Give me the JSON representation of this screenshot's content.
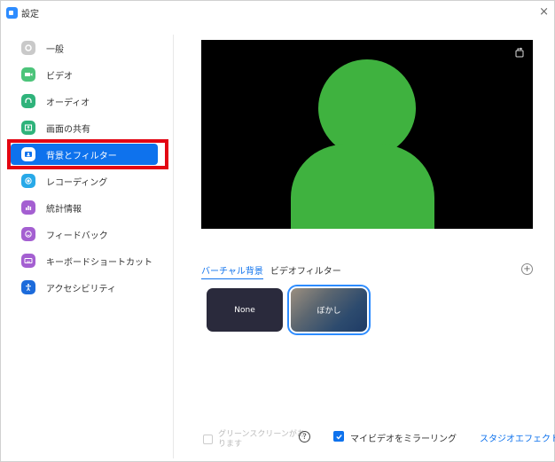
{
  "window": {
    "title": "設定",
    "close_glyph": "×",
    "accent_color": "#2D8CFF",
    "selection_color": "#0E72ED",
    "highlight_color": "#E30613"
  },
  "sidebar": {
    "items": [
      {
        "label": "一般",
        "icon": "gear-icon",
        "color": "#C9C9C9"
      },
      {
        "label": "ビデオ",
        "icon": "video-icon",
        "color": "#4CC47A"
      },
      {
        "label": "オーディオ",
        "icon": "headphones-icon",
        "color": "#2FB37B"
      },
      {
        "label": "画面の共有",
        "icon": "share-screen-icon",
        "color": "#2FB37B"
      },
      {
        "label": "背景とフィルター",
        "icon": "background-icon",
        "color": "#2D8CFF",
        "selected": true
      },
      {
        "label": "レコーディング",
        "icon": "record-icon",
        "color": "#28A9E8"
      },
      {
        "label": "統計情報",
        "icon": "stats-icon",
        "color": "#A45FD1"
      },
      {
        "label": "フィードバック",
        "icon": "feedback-icon",
        "color": "#A45FD1"
      },
      {
        "label": "キーボードショートカット",
        "icon": "keyboard-icon",
        "color": "#A45FD1"
      },
      {
        "label": "アクセシビリティ",
        "icon": "accessibility-icon",
        "color": "#1C6BDB"
      }
    ]
  },
  "preview": {
    "icon": "rotate-camera-icon",
    "avatar_color": "#3FB23F"
  },
  "tabs": [
    {
      "label": "バーチャル背景",
      "active": true
    },
    {
      "label": "ビデオフィルター",
      "active": false
    }
  ],
  "add_button": {
    "glyph": "+",
    "icon": "add-icon"
  },
  "backgrounds": [
    {
      "label": "None"
    },
    {
      "label": "ぼかし",
      "selected": true
    }
  ],
  "footer": {
    "green_screen_label": "グリーンスクリーンがあります",
    "green_screen_checked": false,
    "help_glyph": "?",
    "mirror_label": "マイビデオをミラーリング",
    "mirror_checked": true,
    "studio_effects_link": "スタジオエフェクト"
  }
}
